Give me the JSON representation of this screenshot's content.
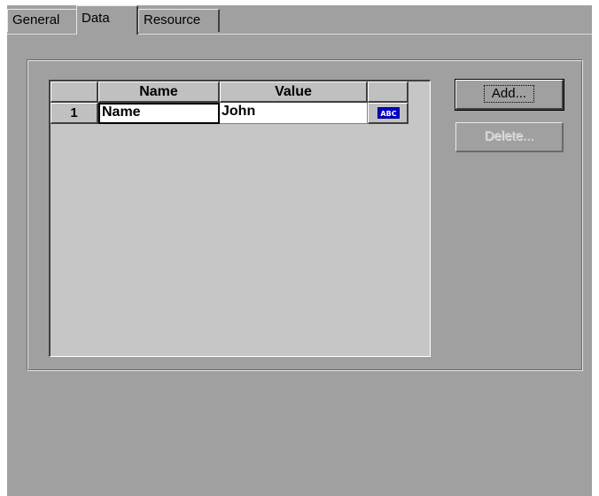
{
  "tabs": [
    {
      "label": "General"
    },
    {
      "label": "Data"
    },
    {
      "label": "Resource"
    }
  ],
  "active_tab": "Data",
  "grid": {
    "columns": [
      "",
      "Name",
      "Value",
      ""
    ],
    "rows": [
      {
        "num": "1",
        "name": "Name",
        "value": "John",
        "type_icon": "ABC"
      }
    ]
  },
  "buttons": {
    "add_label": "Add...",
    "delete_label": "Delete..."
  },
  "colors": {
    "dialog_bg": "#a0a0a0",
    "grid_bg": "#c6c6c6",
    "type_icon_bg": "#0000c8"
  }
}
